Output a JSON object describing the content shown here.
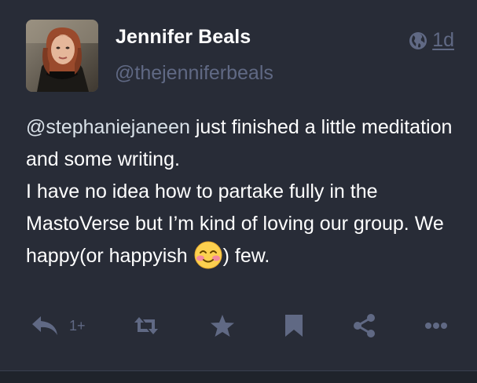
{
  "status": {
    "author": {
      "display_name": "Jennifer Beals",
      "handle": "@thejenniferbeals",
      "avatar_icon": "user-avatar"
    },
    "visibility_icon": "globe-icon",
    "timestamp": "1d",
    "content": {
      "mention": "@stephaniejaneen",
      "line1_rest": " just finished a little meditation and some writing.",
      "line2": "I have no idea how to partake fully in the MastoVerse but I’m kind of loving our group. We happy(or happyish ",
      "emoji_name": "smiling-face-with-blush-emoji",
      "line2_end": ") few."
    },
    "actions": {
      "reply_count": "1+",
      "reply_icon": "reply-all-icon",
      "boost_icon": "retweet-icon",
      "favourite_icon": "star-icon",
      "bookmark_icon": "bookmark-icon",
      "share_icon": "share-icon",
      "more_icon": "ellipsis-icon"
    }
  },
  "colors": {
    "background": "#282c37",
    "muted_text": "#606984",
    "primary_text": "#ffffff",
    "divider": "#1f232b"
  }
}
